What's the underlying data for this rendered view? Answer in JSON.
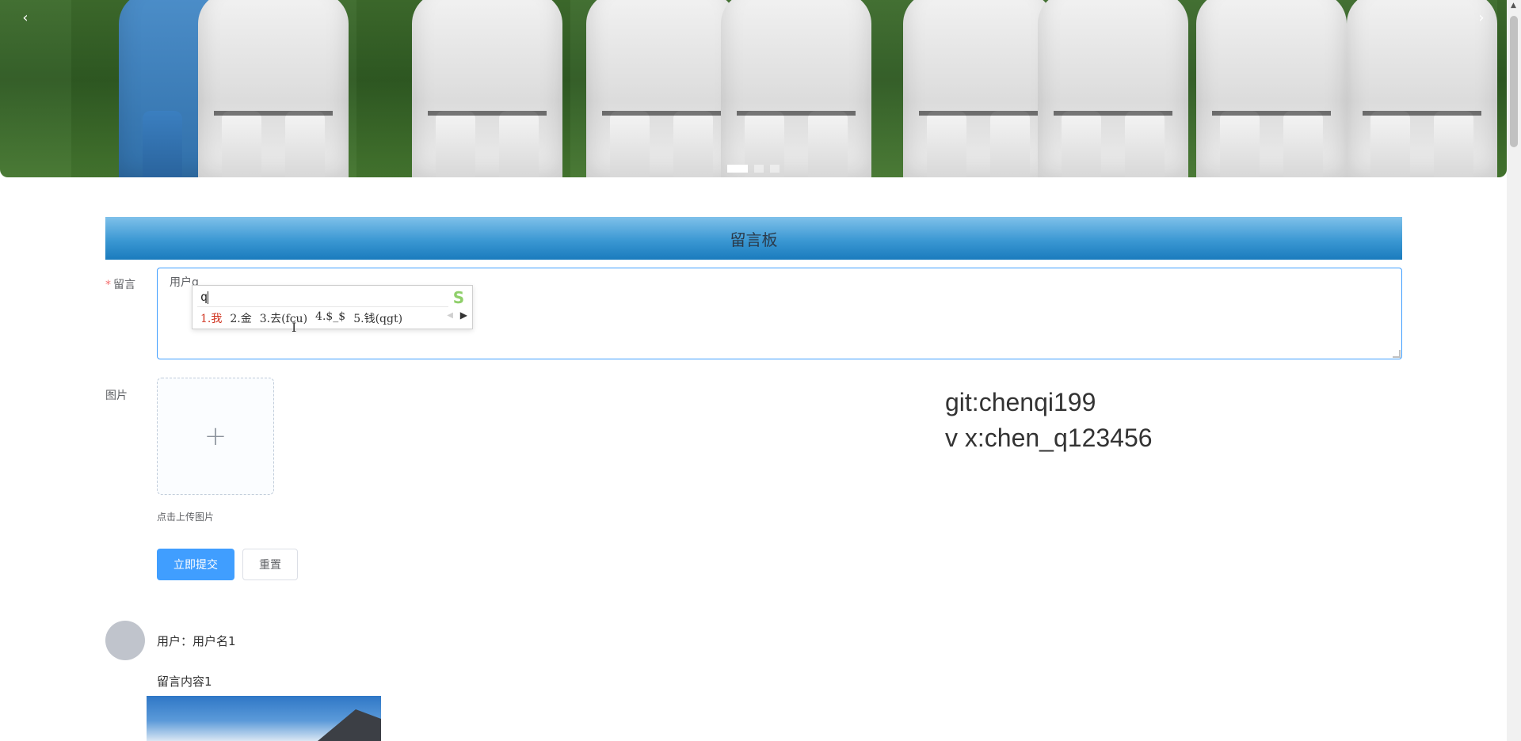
{
  "banner": {
    "prev_arrow": "‹",
    "next_arrow": "›",
    "slide_count": 3,
    "active_slide": 1
  },
  "board": {
    "title": "留言板"
  },
  "form": {
    "message_label": "留言",
    "required_mark": "*",
    "message_value": "用户q",
    "image_label": "图片",
    "upload_plus": "+",
    "upload_tip": "点击上传图片",
    "submit_label": "立即提交",
    "reset_label": "重置"
  },
  "ime": {
    "input": "q",
    "logo": "S",
    "candidates": [
      "1.我",
      "2.金",
      "3.去(fcu)",
      "4.$_$",
      "5.钱(qgt)"
    ],
    "page_left": "◀",
    "page_right": "▶"
  },
  "contact": {
    "git": "git:chenqi199",
    "vx": "v x:chen_q123456"
  },
  "messages": [
    {
      "user": "用户：用户名1",
      "content": "留言内容1"
    }
  ],
  "colors": {
    "primary": "#409eff",
    "header_blue": "#3b98d3",
    "required": "#f56c6c",
    "ime_highlight": "#d0331f"
  }
}
